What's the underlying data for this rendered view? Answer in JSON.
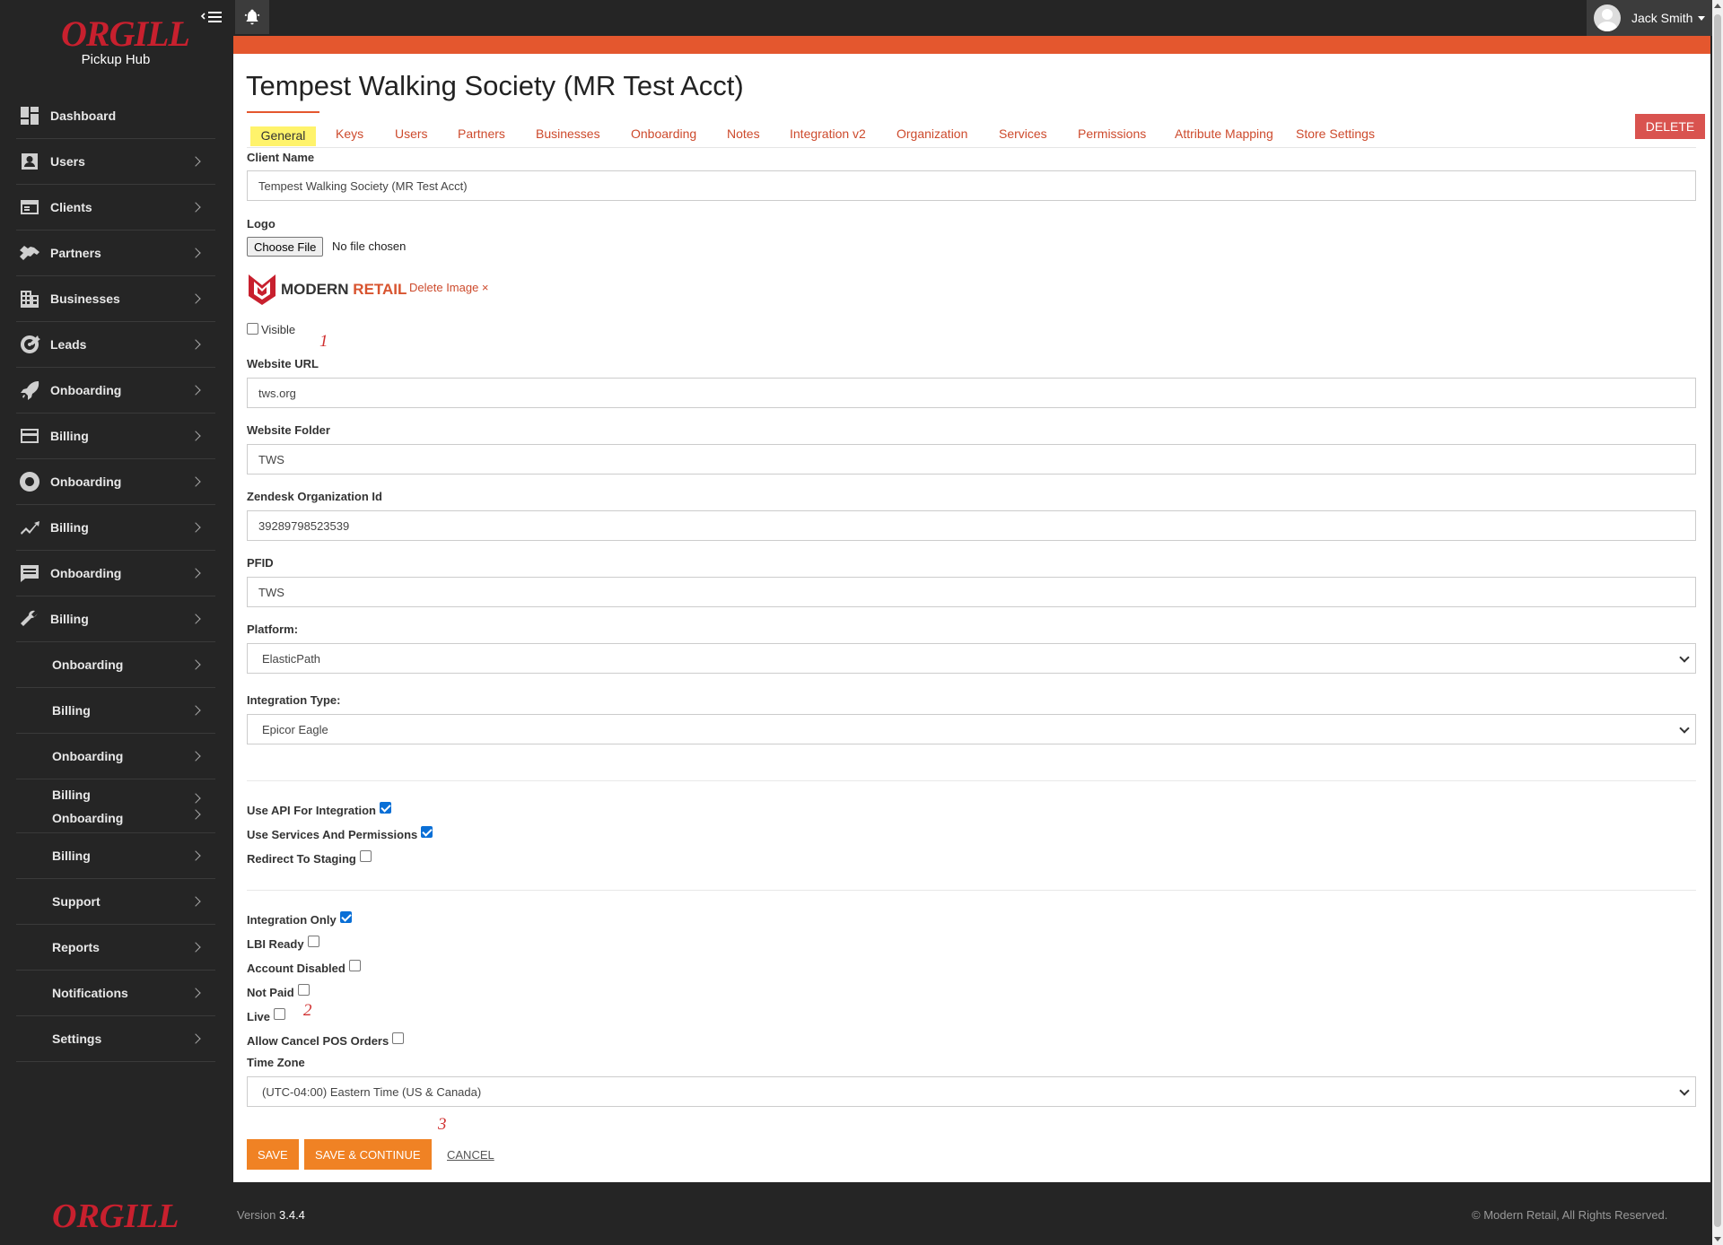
{
  "brand": {
    "name": "ORGILL",
    "subtitle": "Pickup Hub"
  },
  "sidebar": {
    "items": [
      {
        "label": "Dashboard",
        "icon": "dashboard-icon"
      },
      {
        "label": "Users",
        "icon": "user-icon"
      },
      {
        "label": "Clients",
        "icon": "clients-card-icon"
      },
      {
        "label": "Partners",
        "icon": "handshake-icon"
      },
      {
        "label": "Businesses",
        "icon": "building-icon"
      },
      {
        "label": "Leads",
        "icon": "target-icon"
      },
      {
        "label": "Onboarding",
        "icon": "rocket-icon"
      },
      {
        "label": "Billing",
        "icon": "credit-card-icon"
      },
      {
        "label": "Onboarding",
        "icon": "lifebuoy-icon"
      },
      {
        "label": "Billing",
        "icon": "trend-chart-icon"
      },
      {
        "label": "Onboarding",
        "icon": "chat-icon"
      },
      {
        "label": "Billing",
        "icon": "wrench-icon"
      },
      {
        "label": "Onboarding"
      },
      {
        "label": "Billing"
      },
      {
        "label": "Onboarding"
      },
      {
        "label": "Billing",
        "label2": "Onboarding"
      },
      {
        "label": "Billing"
      },
      {
        "label": "Support"
      },
      {
        "label": "Reports"
      },
      {
        "label": "Notifications"
      },
      {
        "label": "Settings"
      }
    ]
  },
  "topbar": {
    "user_name": "Jack Smith"
  },
  "page": {
    "title": "Tempest Walking Society (MR Test Acct)",
    "tabs": [
      "General",
      "Keys",
      "Users",
      "Partners",
      "Businesses",
      "Onboarding",
      "Notes",
      "Integration v2",
      "Organization",
      "Services",
      "Permissions",
      "Attribute Mapping",
      "Store Settings"
    ],
    "active_tab": "General",
    "delete_label": "DELETE"
  },
  "form": {
    "client_name": {
      "label": "Client Name",
      "value": "Tempest Walking Society (MR Test Acct)"
    },
    "logo": {
      "label": "Logo",
      "choose_file": "Choose File",
      "file_status": "No file chosen",
      "logo_word_a": "MODERN",
      "logo_word_b": "RETAIL",
      "delete_image": "Delete Image ×"
    },
    "visible": {
      "label": "Visible",
      "checked": false
    },
    "website_url": {
      "label": "Website URL",
      "value": "tws.org"
    },
    "website_folder": {
      "label": "Website Folder",
      "value": "TWS"
    },
    "zendesk_org": {
      "label": "Zendesk Organization Id",
      "value": "39289798523539"
    },
    "pfid": {
      "label": "PFID",
      "value": "TWS"
    },
    "platform": {
      "label": "Platform:",
      "value": "ElasticPath"
    },
    "integration_type": {
      "label": "Integration Type:",
      "value": "Epicor Eagle"
    },
    "checks_a": [
      {
        "label": "Use API For Integration",
        "checked": true
      },
      {
        "label": "Use Services And Permissions",
        "checked": true
      },
      {
        "label": "Redirect To Staging",
        "checked": false
      }
    ],
    "checks_b": [
      {
        "label": "Integration Only",
        "checked": true
      },
      {
        "label": "LBI Ready",
        "checked": false
      },
      {
        "label": "Account Disabled",
        "checked": false
      },
      {
        "label": "Not Paid",
        "checked": false
      },
      {
        "label": "Live",
        "checked": false
      },
      {
        "label": "Allow Cancel POS Orders",
        "checked": false
      }
    ],
    "time_zone": {
      "label": "Time Zone",
      "value": "(UTC-04:00) Eastern Time (US & Canada)"
    }
  },
  "actions": {
    "save": "SAVE",
    "save_continue": "SAVE & CONTINUE",
    "cancel": "CANCEL"
  },
  "annotations": [
    "1",
    "2",
    "3"
  ],
  "footer": {
    "version_label": "Version",
    "version": "3.4.4",
    "copyright": "© Modern Retail, All Rights Reserved.",
    "logo": "ORGILL"
  },
  "colors": {
    "accent": "#e4572e",
    "button": "#f08224",
    "danger": "#d9534f",
    "sidebar": "#252525",
    "brand_red": "#c8202e"
  }
}
